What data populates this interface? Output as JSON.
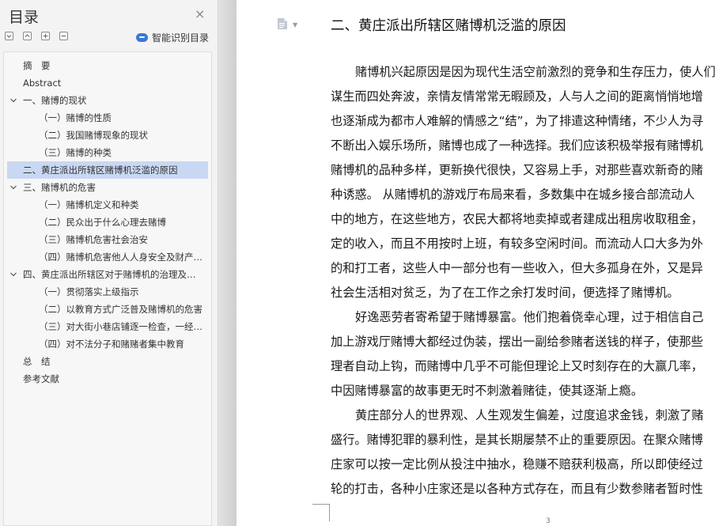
{
  "sidebar": {
    "title": "目录",
    "close_label": "×",
    "smart_label": "智能识别目录",
    "toc": [
      {
        "label": "摘　要",
        "level": 0,
        "expandable": false
      },
      {
        "label": "Abstract",
        "level": 0,
        "expandable": false
      },
      {
        "label": "一、赌博的现状",
        "level": 0,
        "expandable": true
      },
      {
        "label": "（一）赌博的性质",
        "level": 1,
        "expandable": false
      },
      {
        "label": "（二）我国赌博现象的现状",
        "level": 1,
        "expandable": false
      },
      {
        "label": "（三）赌博的种类",
        "level": 1,
        "expandable": false
      },
      {
        "label": "二、黄庄派出所辖区赌博机泛滥的原因",
        "level": 0,
        "expandable": false,
        "selected": true
      },
      {
        "label": "三、赌博机的危害",
        "level": 0,
        "expandable": true
      },
      {
        "label": "（一）赌博机定义和种类",
        "level": 1,
        "expandable": false
      },
      {
        "label": "（二）民众出于什么心理去赌博",
        "level": 1,
        "expandable": false
      },
      {
        "label": "（三）赌博机危害社会治安",
        "level": 1,
        "expandable": false
      },
      {
        "label": "（四）赌博机危害他人人身安全及财产安全",
        "level": 1,
        "expandable": false
      },
      {
        "label": "四、黄庄派出所辖区对于赌博机的治理及对策",
        "level": 0,
        "expandable": true
      },
      {
        "label": "（一）贯彻落实上级指示",
        "level": 1,
        "expandable": false
      },
      {
        "label": "（二）以教育方式广泛普及赌博机的危害",
        "level": 1,
        "expandable": false
      },
      {
        "label": "（三）对大街小巷店铺逐一检查，一经发现立即取缔",
        "level": 1,
        "expandable": false
      },
      {
        "label": "（四）对不法分子和赌赌者集中教育",
        "level": 1,
        "expandable": false
      },
      {
        "label": "总　结",
        "level": 0,
        "expandable": false
      },
      {
        "label": "参考文献",
        "level": 0,
        "expandable": false
      }
    ]
  },
  "document": {
    "heading": "二、黄庄派出所辖区赌博机泛滥的原因",
    "page_number": "3",
    "lines": [
      {
        "text": "赌博机兴起原因是因为现代生活空前激烈的竞争和生存压力，使人们",
        "indent": true
      },
      {
        "text": "谋生而四处奔波，亲情友情常常无暇顾及，人与人之间的距离悄悄地增",
        "indent": false
      },
      {
        "text": "也逐渐成为都市人难解的情感之“结”，为了排遣这种情绪，不少人为寻",
        "indent": false
      },
      {
        "text": "不断出入娱乐场所，赌博也成了一种选择。我们应该积极举报有赌博机",
        "indent": false
      },
      {
        "text": "赌博机的品种多样，更新换代很快，又容易上手，对那些喜欢新奇的赌",
        "indent": false
      },
      {
        "text": "种诱惑。 从赌博机的游戏厅布局来看，多数集中在城乡接合部流动人",
        "indent": false
      },
      {
        "text": "中的地方，在这些地方，农民大都将地卖掉或者建成出租房收取租金，",
        "indent": false
      },
      {
        "text": "定的收入，而且不用按时上班，有较多空闲时间。而流动人口大多为外",
        "indent": false
      },
      {
        "text": "的和打工者，这些人中一部分也有一些收入，但大多孤身在外，又是异",
        "indent": false
      },
      {
        "text": "社会生活相对贫乏，为了在工作之余打发时间，便选择了赌博机。",
        "indent": false
      },
      {
        "text": "好逸恶劳者寄希望于赌博暴富。他们抱着侥幸心理，过于相信自己",
        "indent": true
      },
      {
        "text": "加上游戏厅赌博大都经过伪装，摆出一副给参赌者送钱的样子，使那些",
        "indent": false
      },
      {
        "text": "理者自动上钩，而赌博中几乎不可能但理论上又时刻存在的大赢几率，",
        "indent": false
      },
      {
        "text": "中因赌博暴富的故事更无时不刺激着赌徒，使其逐渐上瘾。",
        "indent": false
      },
      {
        "text": "黄庄部分人的世界观、人生观发生偏差，过度追求金钱，刺激了赌",
        "indent": true
      },
      {
        "text": "盛行。赌博犯罪的暴利性，是其长期屡禁不止的重要原因。在聚众赌博",
        "indent": false
      },
      {
        "text": "庄家可以按一定比例从投注中抽水，稳赚不赔获利极高，所以即使经过",
        "indent": false
      },
      {
        "text": "轮的打击，各种小庄家还是以各种方式存在，而且有少数参赌者暂时性",
        "indent": false
      }
    ]
  }
}
